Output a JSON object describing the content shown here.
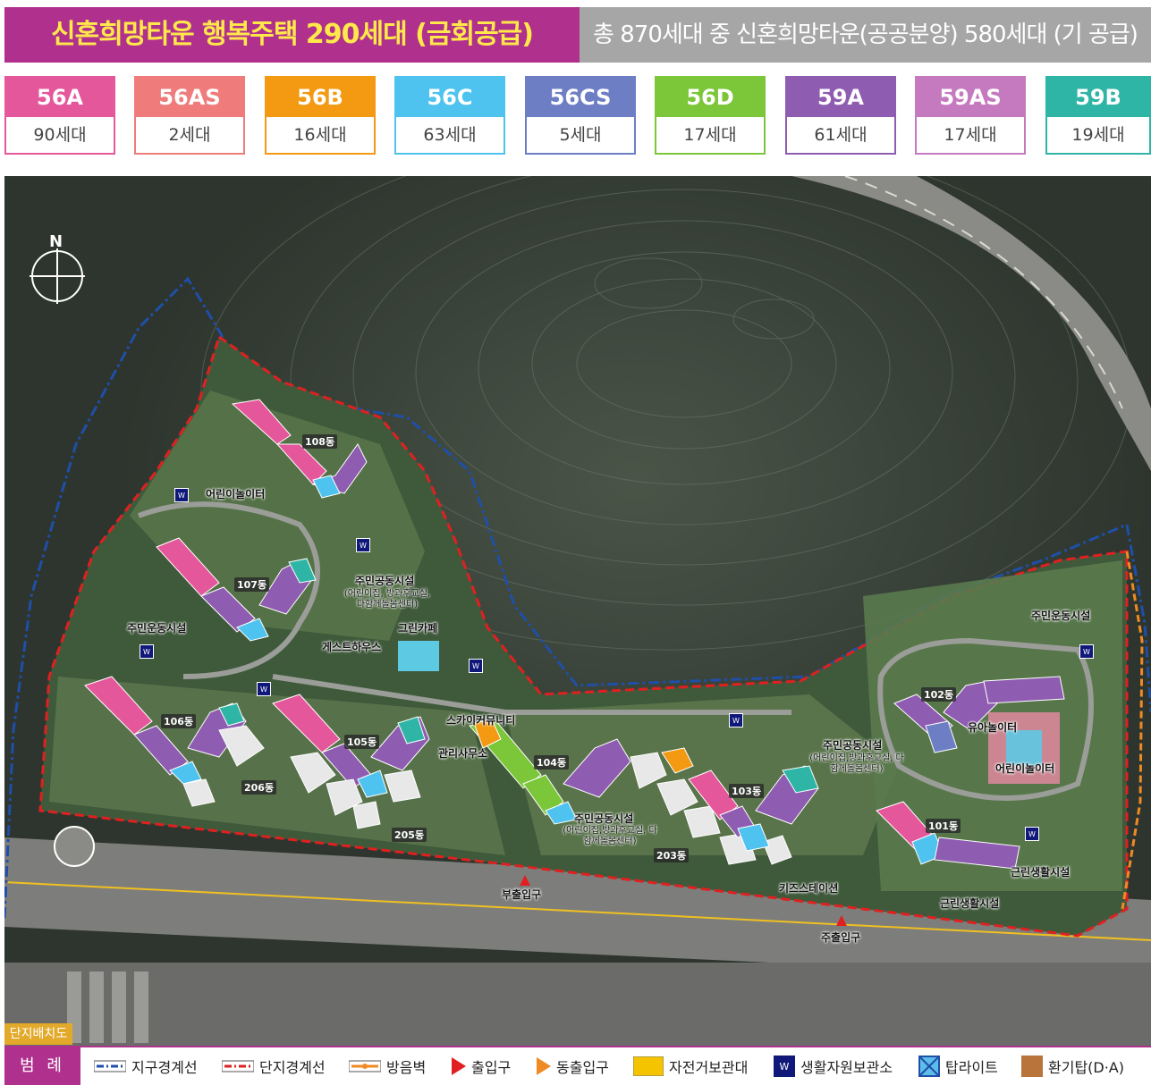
{
  "header": {
    "title": "신혼희망타운 행복주택 290세대 (금회공급)",
    "summary": "총 870세대 중 신혼희망타운(공공분양) 580세대 (기 공급)"
  },
  "units": [
    {
      "type": "56A",
      "count": "90세대",
      "color": "#e5579b"
    },
    {
      "type": "56AS",
      "count": "2세대",
      "color": "#ef7b7b"
    },
    {
      "type": "56B",
      "count": "16세대",
      "color": "#f39a12"
    },
    {
      "type": "56C",
      "count": "63세대",
      "color": "#4fc3ef"
    },
    {
      "type": "56CS",
      "count": "5세대",
      "color": "#6e7ec5"
    },
    {
      "type": "56D",
      "count": "17세대",
      "color": "#7cc63a"
    },
    {
      "type": "59A",
      "count": "61세대",
      "color": "#8e5cb0"
    },
    {
      "type": "59AS",
      "count": "17세대",
      "color": "#c57ac0"
    },
    {
      "type": "59B",
      "count": "19세대",
      "color": "#2fb5a6"
    }
  ],
  "map": {
    "compass": "N",
    "dongs": [
      "108동",
      "107동",
      "106동",
      "206동",
      "105동",
      "205동",
      "104동",
      "203동",
      "103동",
      "102동",
      "101동"
    ],
    "facilities": {
      "kids_play_1": "어린이놀이터",
      "community_1_title": "주민공동시설",
      "community_1_sub": "(어린이집, 방과후교실, 다함께돌봄센터)",
      "green_cafe": "그린카페",
      "guest_house": "게스트하우스",
      "sports_1": "주민운동시설",
      "sky_community": "스카이커뮤니티",
      "management": "관리사무소",
      "community_2_title": "주민공동시설",
      "community_2_sub": "(어린이집,방과후교실, 다함께돌봄센터)",
      "community_3_title": "주민공동시설",
      "community_3_sub": "(어린이집,방과후교실, 다함께돌봄센터)",
      "sports_2": "주민운동시설",
      "toddler_play": "유아놀이터",
      "kids_play_2": "어린이놀이터",
      "neighborhood_1": "근린생활시설",
      "neighborhood_2": "근린생활시설",
      "kids_station": "키즈스테이션",
      "sub_entrance": "부출입구",
      "main_entrance": "주출입구"
    },
    "site_label": "단지배치도"
  },
  "legend": {
    "title": "범 례",
    "items": [
      {
        "label": "지구경계선",
        "icon": "district-boundary-line"
      },
      {
        "label": "단지경계선",
        "icon": "complex-boundary-line"
      },
      {
        "label": "방음벽",
        "icon": "soundproof-wall"
      },
      {
        "label": "출입구",
        "icon": "entrance-triangle"
      },
      {
        "label": "동출입구",
        "icon": "building-entrance-triangle"
      },
      {
        "label": "자전거보관대",
        "icon": "bicycle-rack"
      },
      {
        "label": "생활자원보관소",
        "icon": "recycling-storage"
      },
      {
        "label": "탑라이트",
        "icon": "toplight"
      },
      {
        "label": "환기탑(D·A)",
        "icon": "ventilation-tower"
      }
    ],
    "colors": {
      "district": "#1f4fa8",
      "complex": "#e02020",
      "soundwall": "#f08a24",
      "entrance": "#e02020",
      "bldg_entrance": "#f08a24",
      "bike": "#f5c400",
      "recycle": "#10197a",
      "toplight": "#2d8fd1",
      "vent": "#b8743a"
    }
  }
}
